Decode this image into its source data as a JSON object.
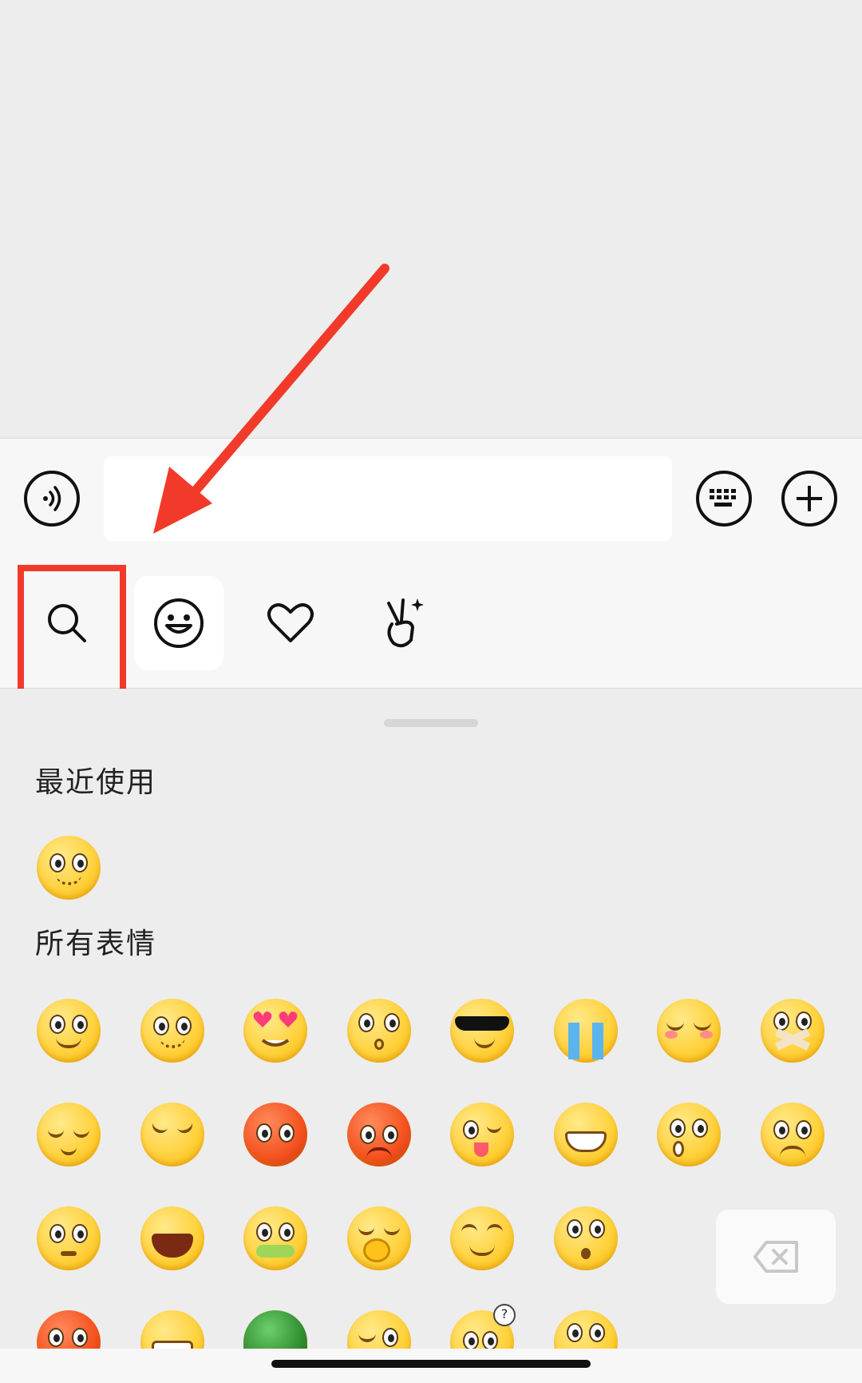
{
  "input_bar": {
    "voice_icon": "voice-icon",
    "keyboard_icon": "keyboard-icon",
    "add_icon": "plus-circle-icon",
    "text_value": ""
  },
  "tabs": [
    {
      "name": "search",
      "icon": "search-icon",
      "active": false
    },
    {
      "name": "emoji",
      "icon": "smiley-icon",
      "active": true
    },
    {
      "name": "favorites",
      "icon": "heart-icon",
      "active": false
    },
    {
      "name": "stickers",
      "icon": "victory-hand-icon",
      "active": false
    }
  ],
  "sections": {
    "recent_title": "最近使用",
    "all_title": "所有表情"
  },
  "colors": {
    "highlight": "#f23a2a",
    "background": "#ededed",
    "emoji_yellow": "#ffd23f"
  }
}
